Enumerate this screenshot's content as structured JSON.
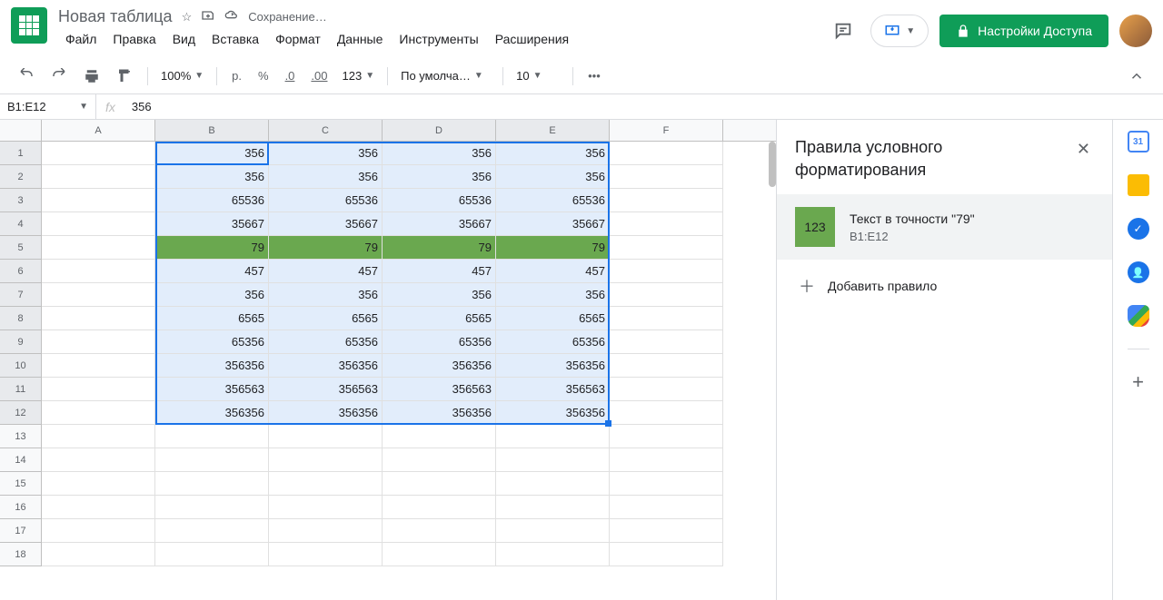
{
  "header": {
    "title": "Новая таблица",
    "save_status": "Сохранение…"
  },
  "menu": {
    "file": "Файл",
    "edit": "Правка",
    "view": "Вид",
    "insert": "Вставка",
    "format": "Формат",
    "data": "Данные",
    "tools": "Инструменты",
    "extensions": "Расширения"
  },
  "share_button": "Настройки Доступа",
  "toolbar": {
    "zoom": "100%",
    "currency": "р.",
    "percent": "%",
    "dec_dec": ".0",
    "inc_dec": ".00",
    "num_format": "123",
    "font": "По умолча…",
    "font_size": "10"
  },
  "formula_bar": {
    "range": "B1:E12",
    "value": "356"
  },
  "columns": [
    "A",
    "B",
    "C",
    "D",
    "E",
    "F"
  ],
  "grid": {
    "rows": [
      [
        "",
        "356",
        "356",
        "356",
        "356",
        ""
      ],
      [
        "",
        "356",
        "356",
        "356",
        "356",
        ""
      ],
      [
        "",
        "65536",
        "65536",
        "65536",
        "65536",
        ""
      ],
      [
        "",
        "35667",
        "35667",
        "35667",
        "35667",
        ""
      ],
      [
        "",
        "79",
        "79",
        "79",
        "79",
        ""
      ],
      [
        "",
        "457",
        "457",
        "457",
        "457",
        ""
      ],
      [
        "",
        "356",
        "356",
        "356",
        "356",
        ""
      ],
      [
        "",
        "6565",
        "6565",
        "6565",
        "6565",
        ""
      ],
      [
        "",
        "65356",
        "65356",
        "65356",
        "65356",
        ""
      ],
      [
        "",
        "356356",
        "356356",
        "356356",
        "356356",
        ""
      ],
      [
        "",
        "356563",
        "356563",
        "356563",
        "356563",
        ""
      ],
      [
        "",
        "356356",
        "356356",
        "356356",
        "356356",
        ""
      ],
      [
        "",
        "",
        "",
        "",
        "",
        ""
      ],
      [
        "",
        "",
        "",
        "",
        "",
        ""
      ],
      [
        "",
        "",
        "",
        "",
        "",
        ""
      ],
      [
        "",
        "",
        "",
        "",
        "",
        ""
      ],
      [
        "",
        "",
        "",
        "",
        "",
        ""
      ],
      [
        "",
        "",
        "",
        "",
        "",
        ""
      ]
    ]
  },
  "sidebar": {
    "title": "Правила условного форматирования",
    "rule": {
      "swatch_text": "123",
      "condition": "Текст в точности \"79\"",
      "range": "B1:E12"
    },
    "add_rule": "Добавить правило"
  },
  "calendar_day": "31"
}
